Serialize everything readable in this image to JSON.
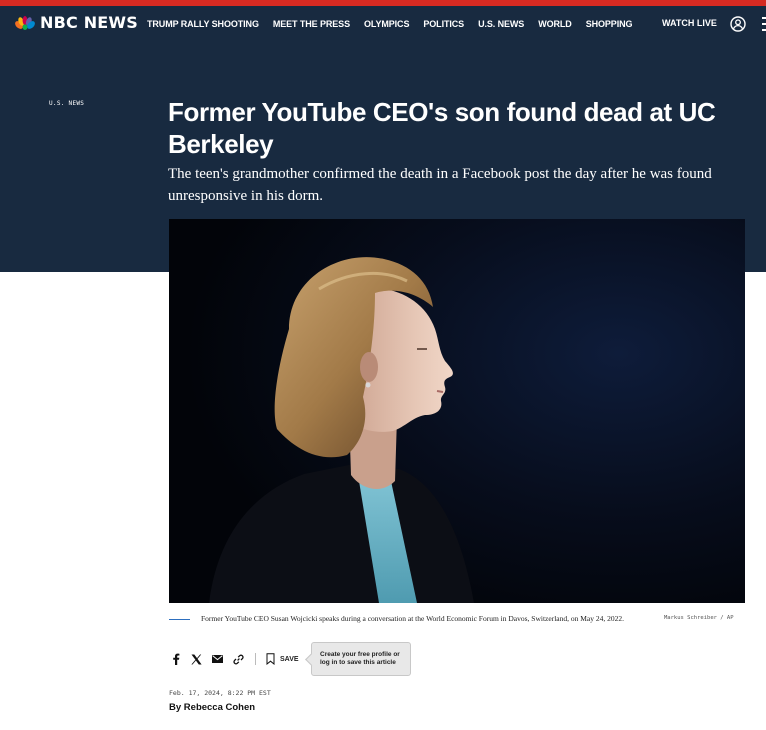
{
  "brand": {
    "logo_text": "NBC NEWS",
    "colors": {
      "top_stripe": "#d72a22",
      "header_bg": "#182a40",
      "caption_rule": "#2d6fbf"
    }
  },
  "nav": {
    "links": [
      "TRUMP RALLY SHOOTING",
      "MEET THE PRESS",
      "OLYMPICS",
      "POLITICS",
      "U.S. NEWS",
      "WORLD",
      "SHOPPING"
    ],
    "watch_live": "WATCH LIVE",
    "account_icon": "user-circle-icon",
    "menu_icon": "hamburger-menu-icon"
  },
  "article": {
    "section": "U.S. NEWS",
    "headline": "Former YouTube CEO's son found dead at UC Berkeley",
    "dek": "The teen's grandmother confirmed the death in a Facebook post the day after he was found unresponsive in his dorm.",
    "image_caption": "Former YouTube CEO Susan Wojcicki speaks during a conversation at the World Economic Forum in Davos, Switzerland, on May 24, 2022.",
    "image_credit": "Markus Schreiber / AP",
    "timestamp": "Feb. 17, 2024, 8:22 PM EST",
    "byline_prefix": "By",
    "author": "Rebecca Cohen"
  },
  "share": {
    "icons": [
      "facebook-icon",
      "x-twitter-icon",
      "email-icon",
      "link-icon"
    ],
    "save_label": "SAVE",
    "save_tooltip": "Create your free profile or log in to save this article"
  }
}
